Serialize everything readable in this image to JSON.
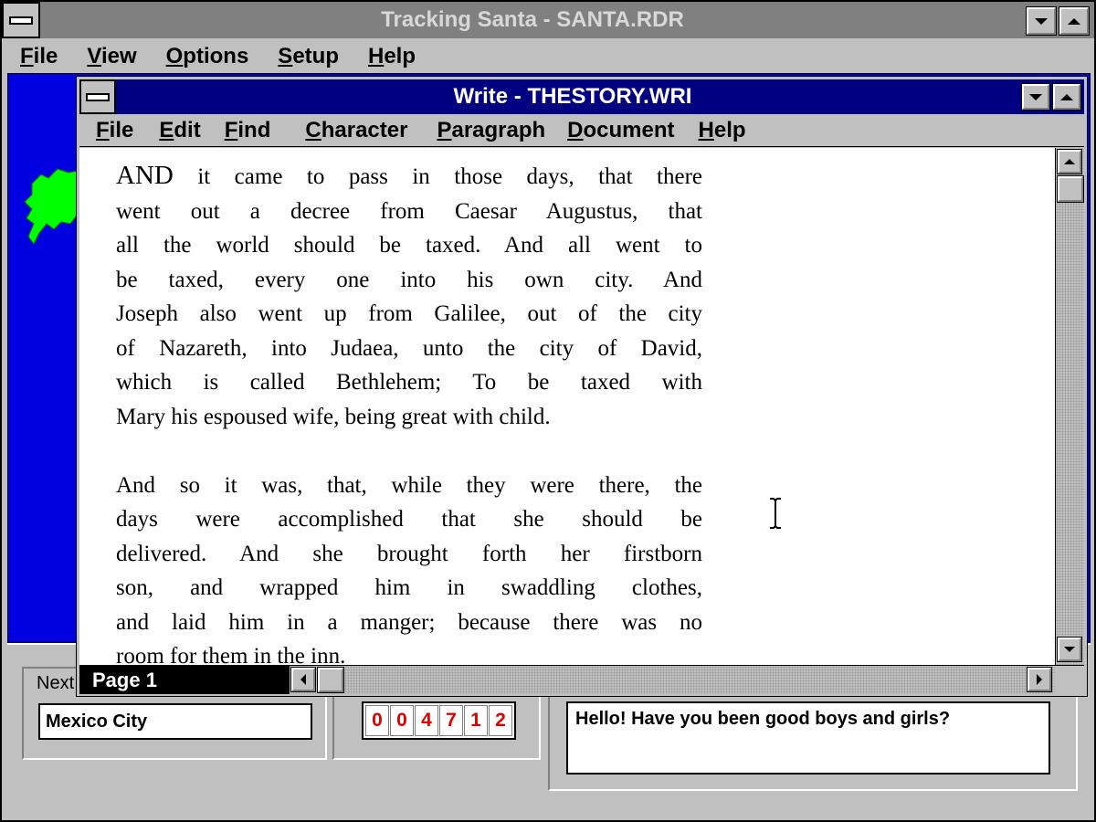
{
  "outer_window": {
    "title": "Tracking Santa - SANTA.RDR",
    "menu": [
      "File",
      "View",
      "Options",
      "Setup",
      "Help"
    ]
  },
  "write_window": {
    "title": "Write - THESTORY.WRI",
    "menu": [
      "File",
      "Edit",
      "Find",
      "Character",
      "Paragraph",
      "Document",
      "Help"
    ],
    "page_label": "Page 1",
    "paragraph1": {
      "lead_word": "AND",
      "lines": [
        " it came to pass in those days, that there",
        "went out a decree from Caesar Augustus, that",
        "all the world should be taxed.  And all went to",
        "be taxed, every one into his own city.  And",
        "Joseph also went up from Galilee, out of the city",
        "of Nazareth, into Judaea, unto the city of David,",
        "which is called Bethlehem; To be taxed with",
        "Mary his espoused wife, being great with child."
      ]
    },
    "paragraph2": {
      "lines": [
        "And so it was, that, while they were there, the",
        "days were accomplished that she should be",
        "delivered.  And she brought forth her firstborn",
        "son, and wrapped him in swaddling clothes,",
        "and laid him in a manger; because there was no",
        "room for them in the inn."
      ]
    }
  },
  "tracker_panel": {
    "next_label": "Next",
    "next_city": "Mexico City",
    "counter_digits": [
      "0",
      "0",
      "4",
      "7",
      "1",
      "2"
    ],
    "message": "Hello! Have you been good boys and girls?"
  },
  "colors": {
    "active_title": "#000080",
    "inactive_title": "#808080",
    "desktop_blue": "#0000e0",
    "map_green": "#00ff00",
    "counter_red": "#e00000"
  }
}
